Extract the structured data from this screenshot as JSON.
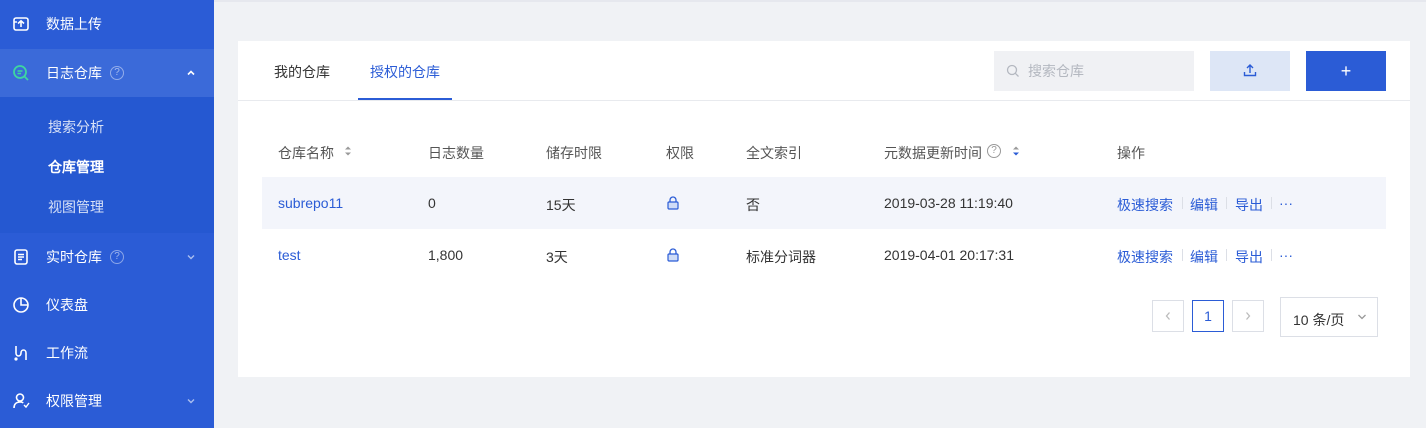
{
  "sidebar": {
    "items": [
      {
        "label": "数据上传",
        "icon": "upload-box-icon"
      },
      {
        "label": "日志仓库",
        "icon": "log-search-icon"
      },
      {
        "label": "实时仓库",
        "icon": "list-doc-icon"
      },
      {
        "label": "仪表盘",
        "icon": "pie-chart-icon"
      },
      {
        "label": "工作流",
        "icon": "workflow-icon"
      },
      {
        "label": "权限管理",
        "icon": "user-permission-icon"
      }
    ],
    "help_glyph": "?",
    "submenu": [
      {
        "label": "搜索分析"
      },
      {
        "label": "仓库管理"
      },
      {
        "label": "视图管理"
      }
    ]
  },
  "tabs": [
    {
      "label": "我的仓库"
    },
    {
      "label": "授权的仓库"
    }
  ],
  "search": {
    "placeholder": "搜索仓库"
  },
  "toolbar": {
    "add_label": "+"
  },
  "table": {
    "headers": {
      "name": "仓库名称",
      "count": "日志数量",
      "retention": "储存时限",
      "permission": "权限",
      "fulltext": "全文索引",
      "updated": "元数据更新时间",
      "actions": "操作"
    },
    "rows": [
      {
        "name": "subrepo11",
        "count": "0",
        "retention": "15天",
        "fulltext": "否",
        "updated": "2019-03-28 11:19:40"
      },
      {
        "name": "test",
        "count": "1,800",
        "retention": "3天",
        "fulltext": "标准分词器",
        "updated": "2019-04-01 20:17:31"
      }
    ],
    "actions": {
      "search": "极速搜索",
      "edit": "编辑",
      "export": "导出",
      "more": "···"
    }
  },
  "pagination": {
    "current": "1",
    "page_size": "10 条/页"
  },
  "colors": {
    "sidebar": "#2b5cd6",
    "accent": "#2b5cd6",
    "background": "#f0f2f5",
    "row_highlight": "#f3f5fb"
  }
}
